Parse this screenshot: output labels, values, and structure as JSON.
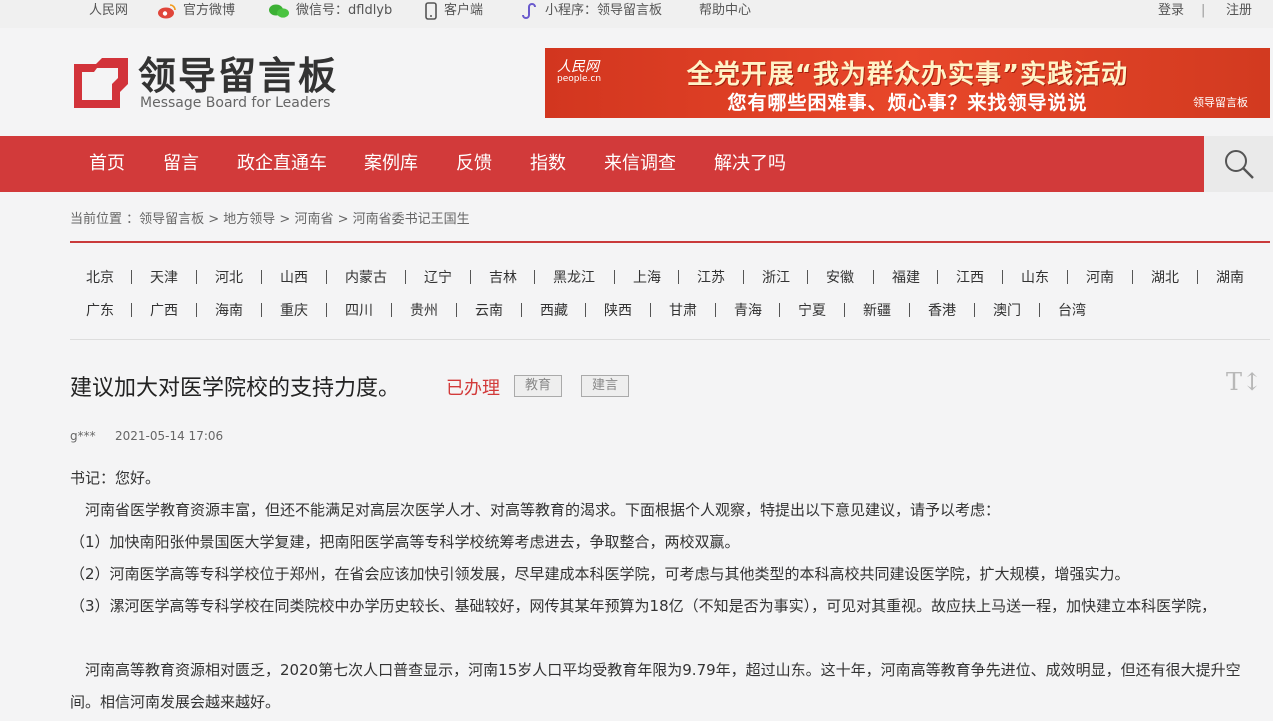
{
  "topbar": {
    "people": "人民网",
    "weibo": "官方微博",
    "wechat": "微信号：dfldlyb",
    "client": "客户端",
    "miniprogram": "小程序：领导留言板",
    "help": "帮助中心",
    "login": "登录",
    "divider": "|",
    "register": "注册"
  },
  "logo": {
    "cn": "领导留言板",
    "en": "Message Board for Leaders"
  },
  "banner": {
    "people_logo": "人民网",
    "people_domain": "people.cn",
    "line1": "全党开展“我为群众办实事”实践活动",
    "line2": "您有哪些困难事、烦心事？来找领导说说",
    "brand": "领导留言板"
  },
  "nav": [
    "首页",
    "留言",
    "政企直通车",
    "案例库",
    "反馈",
    "指数",
    "来信调查",
    "解决了吗"
  ],
  "breadcrumb": "当前位置 ：领导留言板 > 地方领导 > 河南省 > 河南省委书记王国生",
  "provinces_row1": [
    "北京",
    "天津",
    "河北",
    "山西",
    "内蒙古",
    "辽宁",
    "吉林",
    "黑龙江",
    "上海",
    "江苏",
    "浙江",
    "安徽",
    "福建",
    "江西",
    "山东",
    "河南",
    "湖北",
    "湖南"
  ],
  "provinces_row2": [
    "广东",
    "广西",
    "海南",
    "重庆",
    "四川",
    "贵州",
    "云南",
    "西藏",
    "陕西",
    "甘肃",
    "青海",
    "宁夏",
    "新疆",
    "香港",
    "澳门",
    "台湾"
  ],
  "message": {
    "title": "建议加大对医学院校的支持力度。",
    "status": "已办理",
    "tags": [
      "教育",
      "建言"
    ],
    "fontsize_icon": "T↕",
    "author": "g***",
    "date": "2021-05-14 17:06",
    "greeting": "书记：您好。",
    "p1": "　河南省医学教育资源丰富，但还不能满足对高层次医学人才、对高等教育的渴求。下面根据个人观察，特提出以下意见建议，请予以考虑：",
    "p2": "（1）加快南阳张仲景国医大学复建，把南阳医学高等专科学校统筹考虑进去，争取整合，两校双赢。",
    "p3": "（2）河南医学高等专科学校位于郑州，在省会应该加快引领发展，尽早建成本科医学院，可考虑与其他类型的本科高校共同建设医学院，扩大规模，增强实力。",
    "p4": "（3）漯河医学高等专科学校在同类院校中办学历史较长、基础较好，网传其某年预算为18亿（不知是否为事实），可见对其重视。故应扶上马送一程，加快建立本科医学院，",
    "p5": "　河南高等教育资源相对匮乏，2020第七次人口普查显示，河南15岁人口平均受教育年限为9.79年，超过山东。这十年，河南高等教育争先进位、成效明显，但还有很大提升空间。相信河南发展会越来越好。"
  }
}
